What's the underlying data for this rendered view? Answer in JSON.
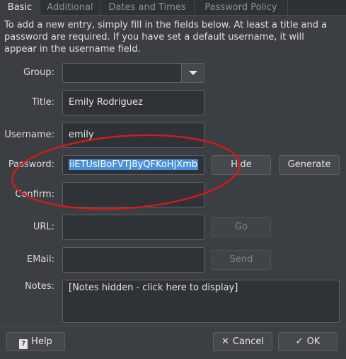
{
  "tabs": [
    "Basic",
    "Additional",
    "Dates and Times",
    "Password Policy"
  ],
  "intro": "To add a new entry, simply fill in the fields below. At least a title and a password are required. If you have set a default username, it will appear in the username field.",
  "labels": {
    "group": "Group:",
    "title": "Title:",
    "username": "Username:",
    "password": "Password:",
    "confirm": "Confirm:",
    "url": "URL:",
    "email": "EMail:",
    "notes": "Notes:"
  },
  "fields": {
    "group": "",
    "title": "Emily Rodriguez",
    "username": "emily",
    "password": "iiETUsIBoFVTj8yQFKoHjXmb",
    "confirm": "",
    "url": "",
    "email": "",
    "notes": "[Notes hidden - click here to display]"
  },
  "buttons": {
    "hide": "Hide",
    "generate": "Generate",
    "go": "Go",
    "send": "Send",
    "help": "Help",
    "cancel": "Cancel",
    "ok": "OK"
  },
  "icons": {
    "help": "help-icon",
    "cancel": "cross-icon",
    "ok": "check-icon",
    "dropdown": "chevron-down-icon"
  },
  "colors": {
    "background": "#3b3e42",
    "selection": "#4a90d9",
    "annotation": "#d01c1c"
  }
}
